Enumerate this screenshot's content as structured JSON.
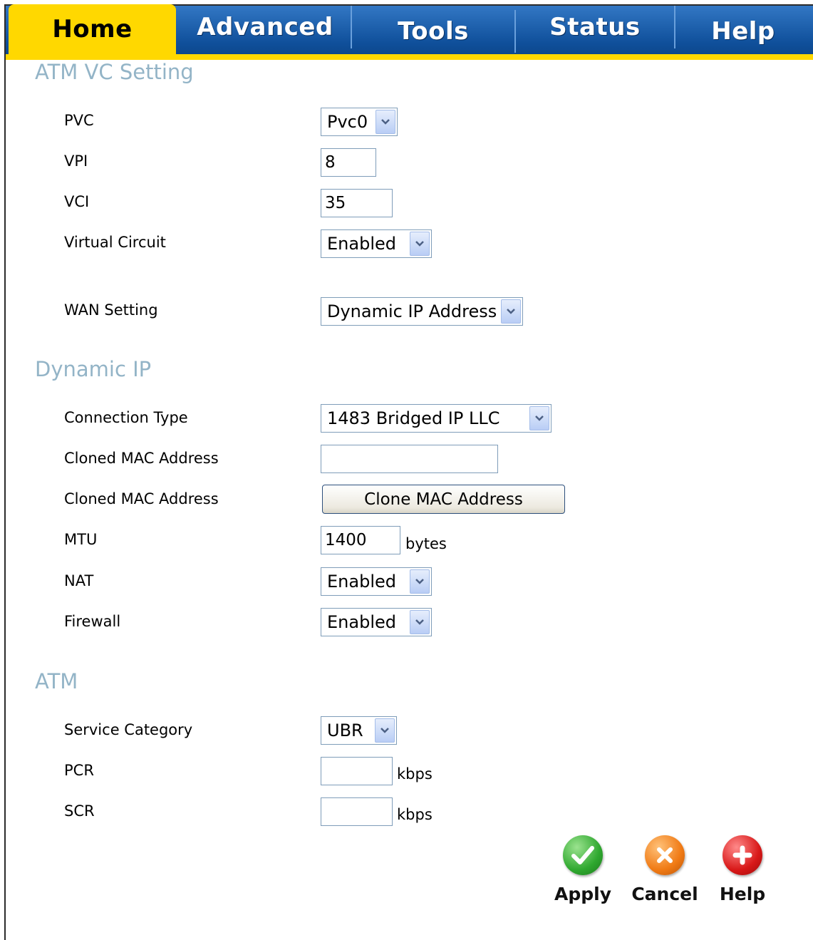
{
  "tabs": [
    {
      "label": "Home",
      "active": true
    },
    {
      "label": "Advanced",
      "active": false
    },
    {
      "label": "Tools",
      "active": false
    },
    {
      "label": "Status",
      "active": false
    },
    {
      "label": "Help",
      "active": false
    }
  ],
  "atm_vc": {
    "title": "ATM VC Setting",
    "pvc": {
      "label": "PVC",
      "value": "Pvc0"
    },
    "vpi": {
      "label": "VPI",
      "value": "8"
    },
    "vci": {
      "label": "VCI",
      "value": "35"
    },
    "virtual_circuit": {
      "label": "Virtual Circuit",
      "value": "Enabled"
    },
    "wan_setting": {
      "label": "WAN Setting",
      "value": "Dynamic IP Address"
    }
  },
  "dynamic_ip": {
    "title": "Dynamic IP",
    "connection_type": {
      "label": "Connection Type",
      "value": "1483 Bridged IP LLC"
    },
    "cloned_mac": {
      "label": "Cloned MAC Address",
      "value": ""
    },
    "clone_button": {
      "label": "Cloned MAC Address",
      "button_text": "Clone MAC Address"
    },
    "mtu": {
      "label": "MTU",
      "value": "1400",
      "unit": "bytes"
    },
    "nat": {
      "label": "NAT",
      "value": "Enabled"
    },
    "firewall": {
      "label": "Firewall",
      "value": "Enabled"
    }
  },
  "atm": {
    "title": "ATM",
    "service_category": {
      "label": "Service Category",
      "value": "UBR"
    },
    "pcr": {
      "label": "PCR",
      "value": "",
      "unit": "kbps"
    },
    "scr": {
      "label": "SCR",
      "value": "",
      "unit": "kbps"
    }
  },
  "actions": {
    "apply": "Apply",
    "cancel": "Cancel",
    "help": "Help"
  },
  "colors": {
    "tab_blue": "#0f4f9a",
    "tab_yellow": "#ffd800",
    "section_title": "#93b4c7",
    "apply_green": "#2fa82f",
    "cancel_orange": "#f07a14",
    "help_red": "#d81818"
  }
}
